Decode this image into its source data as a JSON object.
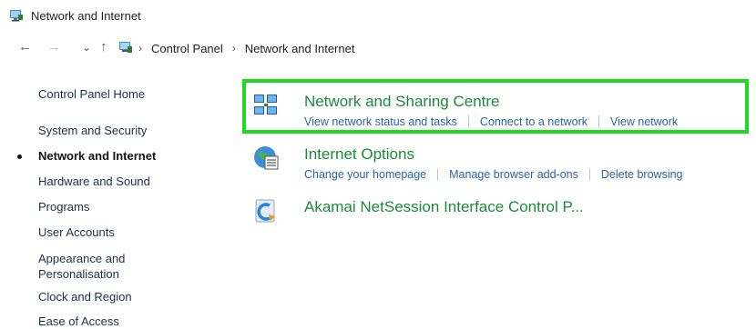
{
  "window": {
    "title": "Network and Internet",
    "icon": "network-icon"
  },
  "address": {
    "back_icon": "←",
    "forward_icon": "→",
    "recent_icon": "⌄",
    "up_icon": "↑",
    "breadcrumbs": [
      "Control Panel",
      "Network and Internet"
    ],
    "separator": "›"
  },
  "sidebar": {
    "items": [
      {
        "label": "Control Panel Home"
      },
      {
        "label": "System and Security"
      },
      {
        "label": "Network and Internet",
        "active": true
      },
      {
        "label": "Hardware and Sound"
      },
      {
        "label": "Programs"
      },
      {
        "label": "User Accounts"
      },
      {
        "label": "Appearance and",
        "label2": "Personalisation"
      },
      {
        "label": "Clock and Region"
      },
      {
        "label": "Ease of Access"
      }
    ]
  },
  "categories": [
    {
      "title": "Network and Sharing Centre",
      "icon": "network-sharing-icon",
      "links": [
        "View network status and tasks",
        "Connect to a network",
        "View network"
      ]
    },
    {
      "title": "Internet Options",
      "icon": "internet-options-icon",
      "links": [
        "Change your homepage",
        "Manage browser add-ons",
        "Delete browsing"
      ]
    },
    {
      "title": "Akamai NetSession Interface Control P...",
      "icon": "akamai-icon",
      "links": []
    }
  ],
  "colors": {
    "highlight": "#1fd81f",
    "category_title": "#1a8a3a",
    "link": "#2a63a8"
  }
}
